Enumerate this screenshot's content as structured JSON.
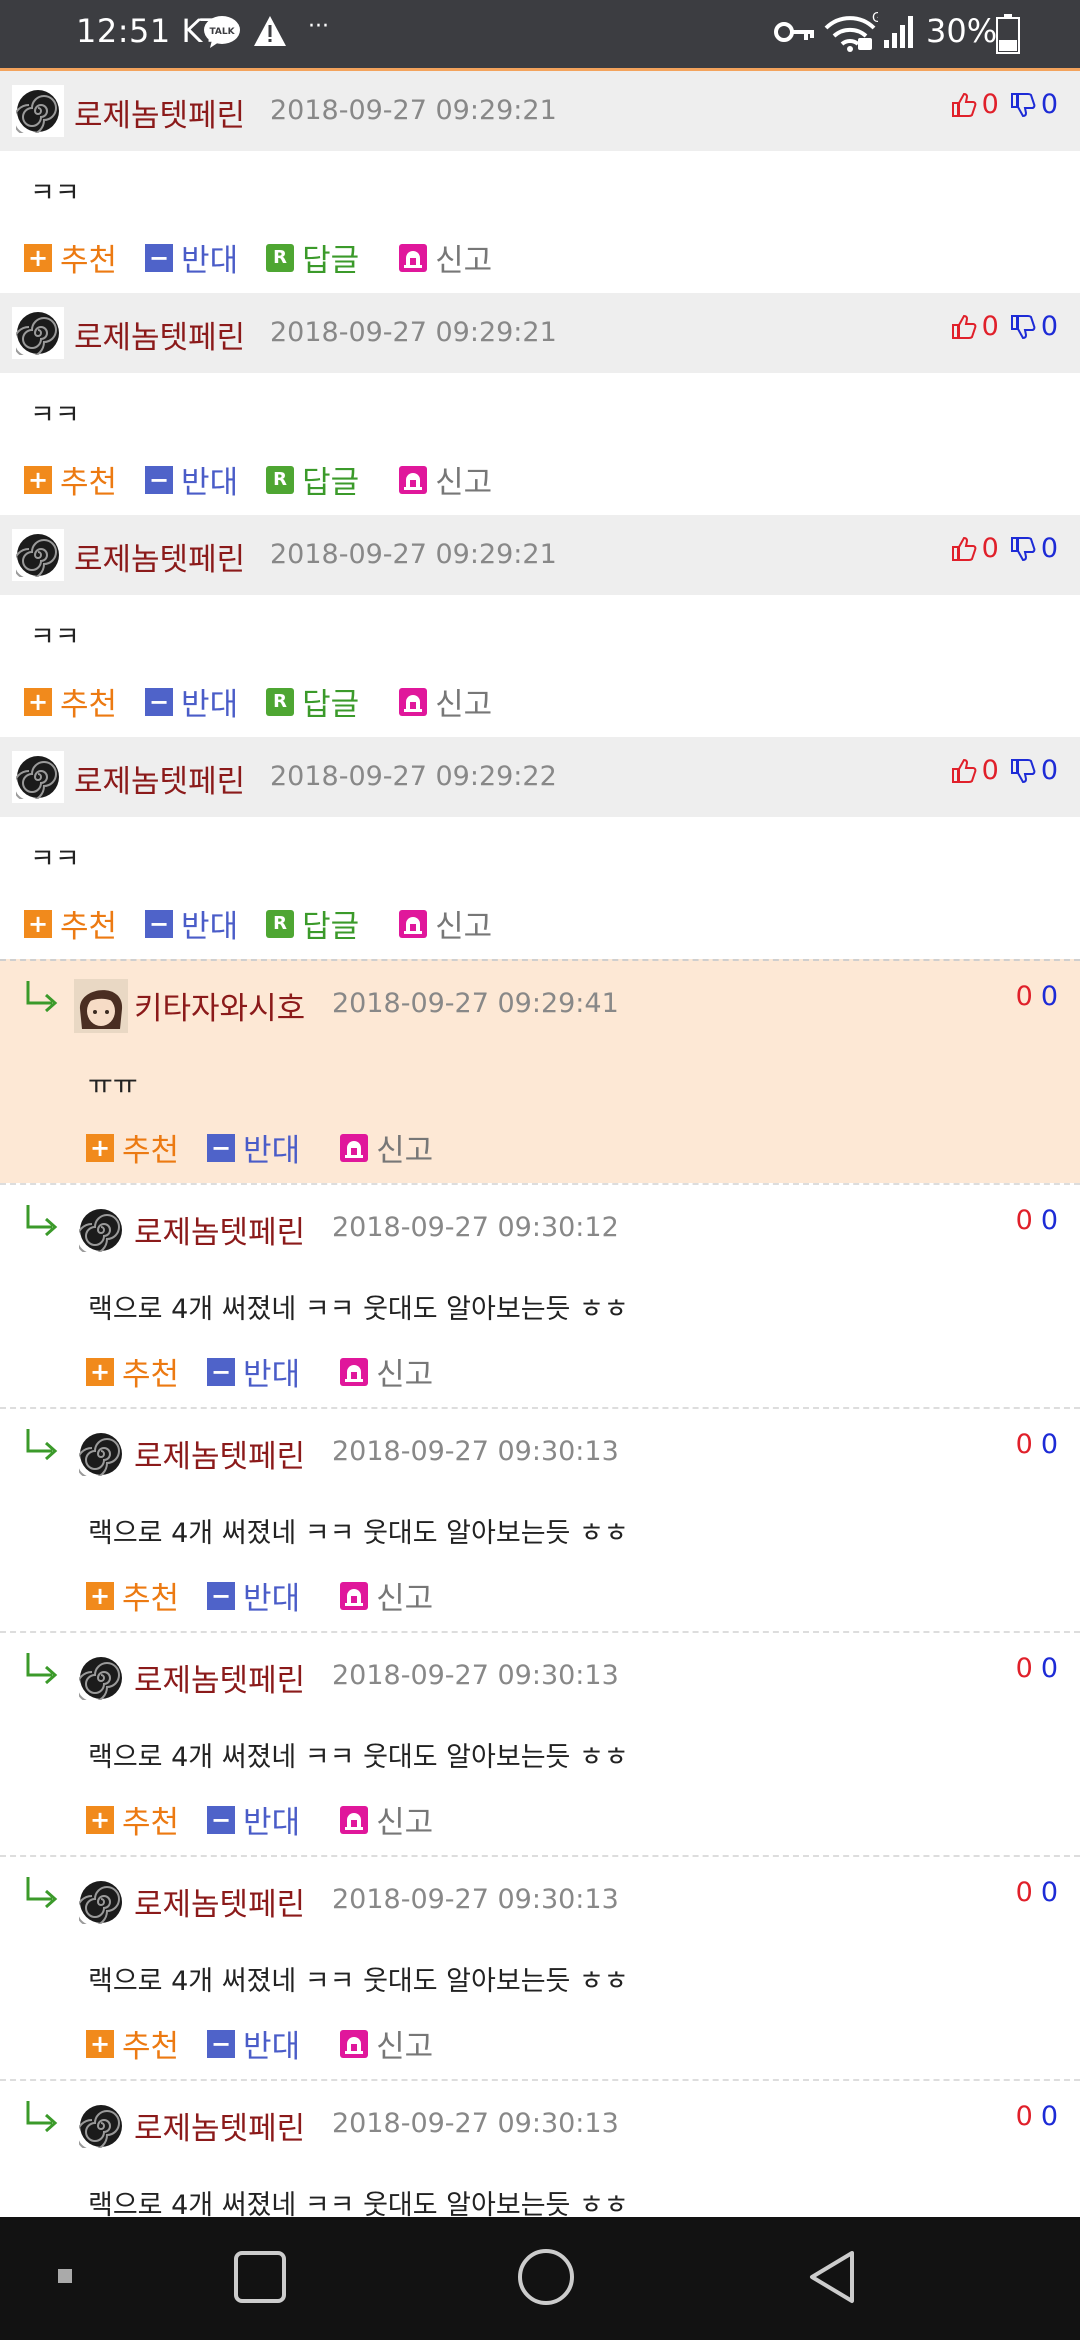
{
  "status_bar": {
    "time": "12:51",
    "carrier": "KT",
    "battery": "30%",
    "network": "G",
    "overflow": "···"
  },
  "colors": {
    "username": "#8b1a1a",
    "recommend": "#ec7a12",
    "oppose": "#4a5cc8",
    "reply": "#3b9a2a",
    "highlight_bg": "#fde8d5",
    "header_bg": "#eeeeee"
  },
  "actions": {
    "recommend": "추천",
    "oppose": "반대",
    "reply": "답글",
    "report": "신고"
  },
  "comments": [
    {
      "user": "로제놈텟페린",
      "date": "2018-09-27 09:29:21",
      "up": "0",
      "down": "0",
      "text": "ㅋㅋ"
    },
    {
      "user": "로제놈텟페린",
      "date": "2018-09-27 09:29:21",
      "up": "0",
      "down": "0",
      "text": "ㅋㅋ"
    },
    {
      "user": "로제놈텟페린",
      "date": "2018-09-27 09:29:21",
      "up": "0",
      "down": "0",
      "text": "ㅋㅋ"
    },
    {
      "user": "로제놈텟페린",
      "date": "2018-09-27 09:29:22",
      "up": "0",
      "down": "0",
      "text": "ㅋㅋ"
    }
  ],
  "replies": [
    {
      "user": "키타자와시호",
      "date": "2018-09-27 09:29:41",
      "up": "0",
      "down": "0",
      "text": "ㅠㅠ",
      "avatar": "character-avatar"
    },
    {
      "user": "로제놈텟페린",
      "date": "2018-09-27 09:30:12",
      "up": "0",
      "down": "0",
      "text": "랙으로 4개 써졌네 ㅋㅋ 웃대도 알아보는듯 ㅎㅎ",
      "avatar": "spiral-avatar"
    },
    {
      "user": "로제놈텟페린",
      "date": "2018-09-27 09:30:13",
      "up": "0",
      "down": "0",
      "text": "랙으로 4개 써졌네 ㅋㅋ 웃대도 알아보는듯 ㅎㅎ",
      "avatar": "spiral-avatar"
    },
    {
      "user": "로제놈텟페린",
      "date": "2018-09-27 09:30:13",
      "up": "0",
      "down": "0",
      "text": "랙으로 4개 써졌네 ㅋㅋ 웃대도 알아보는듯 ㅎㅎ",
      "avatar": "spiral-avatar"
    },
    {
      "user": "로제놈텟페린",
      "date": "2018-09-27 09:30:13",
      "up": "0",
      "down": "0",
      "text": "랙으로 4개 써졌네 ㅋㅋ 웃대도 알아보는듯 ㅎㅎ",
      "avatar": "spiral-avatar"
    },
    {
      "user": "로제놈텟페린",
      "date": "2018-09-27 09:30:13",
      "up": "0",
      "down": "0",
      "text": "랙으로 4개 써졌네 ㅋㅋ 웃대도 알아보는듯 ㅎㅎ",
      "avatar": "spiral-avatar"
    }
  ],
  "nav": {
    "icons": [
      "recents-dot-icon",
      "overview-square-icon",
      "home-circle-icon",
      "back-triangle-icon"
    ]
  }
}
